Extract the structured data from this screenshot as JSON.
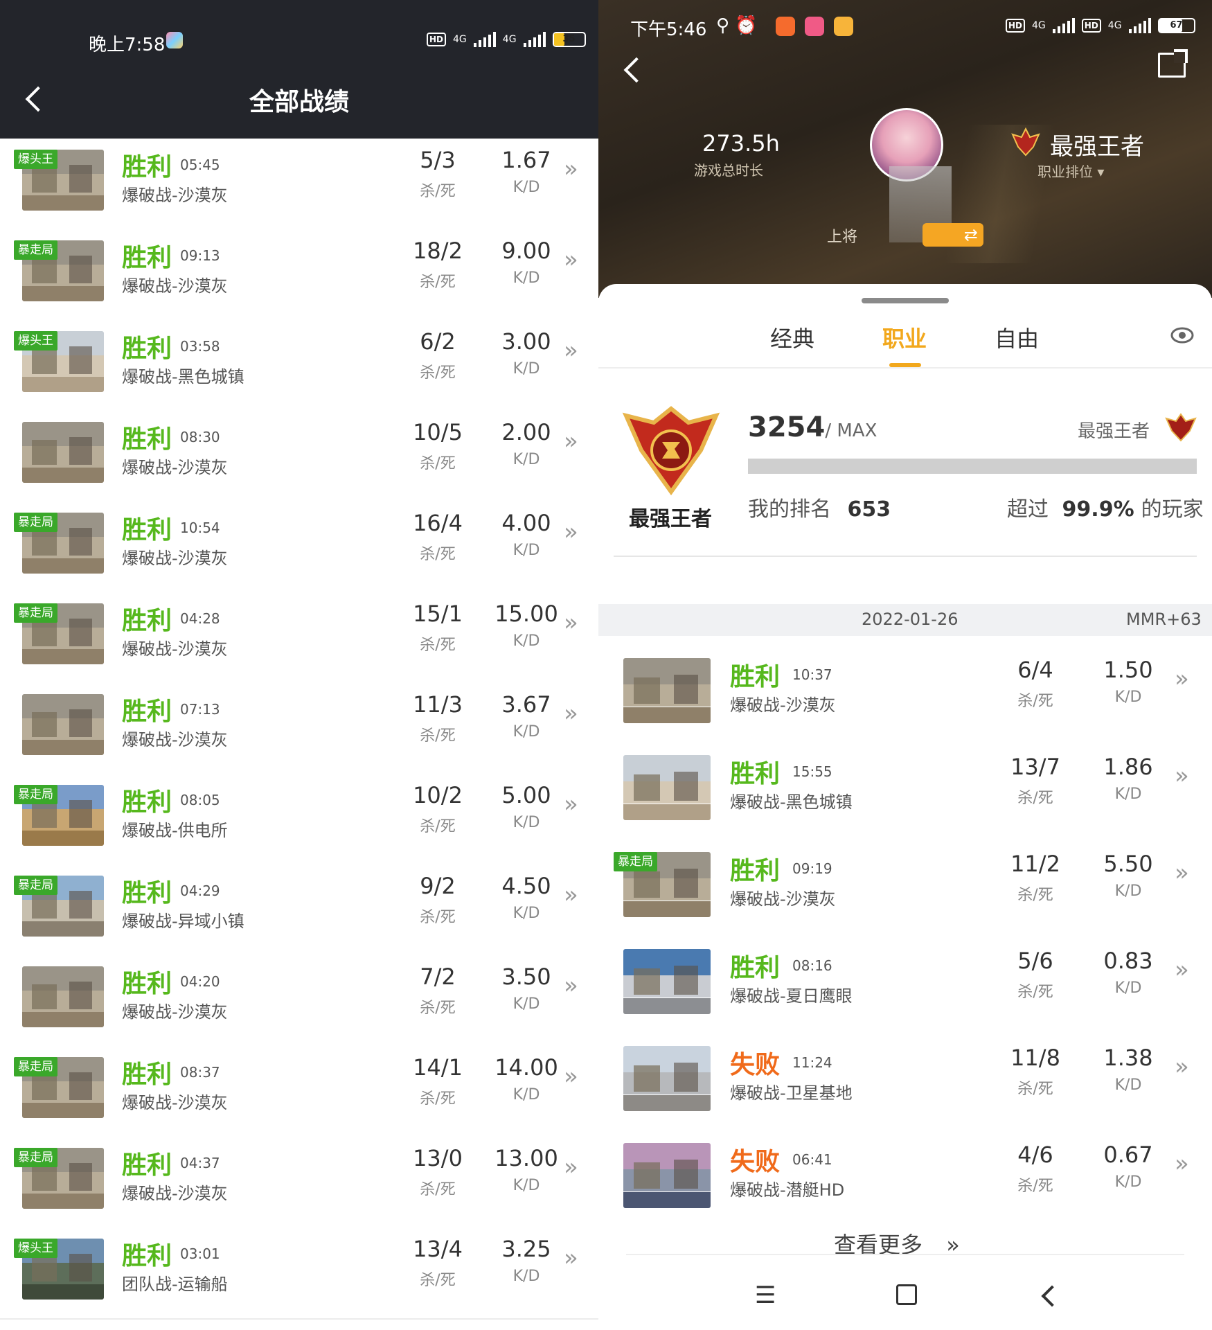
{
  "left": {
    "status": {
      "time": "晚上7:58",
      "network1": "4G",
      "network2": "4G",
      "battery": "35",
      "battery_level": 0.35
    },
    "title": "全部战绩",
    "kd_label_kills": "杀/死",
    "kd_label_ratio": "K/D",
    "matches": [
      {
        "tag": "爆头王",
        "result": "胜利",
        "duration": "05:45",
        "mode": "爆破战-沙漠灰",
        "kills_deaths": "5/3",
        "kd": "1.67",
        "outcome": "win",
        "map": "desert"
      },
      {
        "tag": "暴走局",
        "result": "胜利",
        "duration": "09:13",
        "mode": "爆破战-沙漠灰",
        "kills_deaths": "18/2",
        "kd": "9.00",
        "outcome": "win",
        "map": "desert"
      },
      {
        "tag": "爆头王",
        "result": "胜利",
        "duration": "03:58",
        "mode": "爆破战-黑色城镇",
        "kills_deaths": "6/2",
        "kd": "3.00",
        "outcome": "win",
        "map": "town"
      },
      {
        "tag": "",
        "result": "胜利",
        "duration": "08:30",
        "mode": "爆破战-沙漠灰",
        "kills_deaths": "10/5",
        "kd": "2.00",
        "outcome": "win",
        "map": "desert"
      },
      {
        "tag": "暴走局",
        "result": "胜利",
        "duration": "10:54",
        "mode": "爆破战-沙漠灰",
        "kills_deaths": "16/4",
        "kd": "4.00",
        "outcome": "win",
        "map": "desert"
      },
      {
        "tag": "暴走局",
        "result": "胜利",
        "duration": "04:28",
        "mode": "爆破战-沙漠灰",
        "kills_deaths": "15/1",
        "kd": "15.00",
        "outcome": "win",
        "map": "desert"
      },
      {
        "tag": "",
        "result": "胜利",
        "duration": "07:13",
        "mode": "爆破战-沙漠灰",
        "kills_deaths": "11/3",
        "kd": "3.67",
        "outcome": "win",
        "map": "desert"
      },
      {
        "tag": "暴走局",
        "result": "胜利",
        "duration": "08:05",
        "mode": "爆破战-供电所",
        "kills_deaths": "10/2",
        "kd": "5.00",
        "outcome": "win",
        "map": "power"
      },
      {
        "tag": "暴走局",
        "result": "胜利",
        "duration": "04:29",
        "mode": "爆破战-异域小镇",
        "kills_deaths": "9/2",
        "kd": "4.50",
        "outcome": "win",
        "map": "exotic"
      },
      {
        "tag": "",
        "result": "胜利",
        "duration": "04:20",
        "mode": "爆破战-沙漠灰",
        "kills_deaths": "7/2",
        "kd": "3.50",
        "outcome": "win",
        "map": "desert"
      },
      {
        "tag": "暴走局",
        "result": "胜利",
        "duration": "08:37",
        "mode": "爆破战-沙漠灰",
        "kills_deaths": "14/1",
        "kd": "14.00",
        "outcome": "win",
        "map": "desert"
      },
      {
        "tag": "暴走局",
        "result": "胜利",
        "duration": "04:37",
        "mode": "爆破战-沙漠灰",
        "kills_deaths": "13/0",
        "kd": "13.00",
        "outcome": "win",
        "map": "desert"
      },
      {
        "tag": "爆头王",
        "result": "胜利",
        "duration": "03:01",
        "mode": "团队战-运输船",
        "kills_deaths": "13/4",
        "kd": "3.25",
        "outcome": "win",
        "map": "ship"
      }
    ]
  },
  "right": {
    "status": {
      "time": "下午5:46",
      "network1": "4G",
      "network2": "4G",
      "battery": "67",
      "battery_level": 0.67
    },
    "hero": {
      "play_time": "273.5h",
      "play_time_label": "游戏总时长",
      "rank_title": "最强王者",
      "rank_label": "职业排位",
      "military_rank": "上将"
    },
    "tabs": [
      "经典",
      "职业",
      "自由"
    ],
    "active_tab": 1,
    "rank": {
      "badge_label": "最强王者",
      "score": "3254",
      "max": "/ MAX",
      "tier": "最强王者",
      "my_rank_label": "我的排名",
      "my_rank": "653",
      "exceed_prefix": "超过",
      "exceed_value": "99.9%",
      "exceed_suffix": "的玩家",
      "progress": 1.0
    },
    "date": "2022-01-26",
    "mmr": "MMR+63",
    "kd_label_kills": "杀/死",
    "kd_label_ratio": "K/D",
    "matches": [
      {
        "tag": "",
        "result": "胜利",
        "duration": "10:37",
        "mode": "爆破战-沙漠灰",
        "kills_deaths": "6/4",
        "kd": "1.50",
        "outcome": "win",
        "map": "desert"
      },
      {
        "tag": "",
        "result": "胜利",
        "duration": "15:55",
        "mode": "爆破战-黑色城镇",
        "kills_deaths": "13/7",
        "kd": "1.86",
        "outcome": "win",
        "map": "town"
      },
      {
        "tag": "暴走局",
        "result": "胜利",
        "duration": "09:19",
        "mode": "爆破战-沙漠灰",
        "kills_deaths": "11/2",
        "kd": "5.50",
        "outcome": "win",
        "map": "desert"
      },
      {
        "tag": "",
        "result": "胜利",
        "duration": "08:16",
        "mode": "爆破战-夏日鹰眼",
        "kills_deaths": "5/6",
        "kd": "0.83",
        "outcome": "win",
        "map": "summer"
      },
      {
        "tag": "",
        "result": "失败",
        "duration": "11:24",
        "mode": "爆破战-卫星基地",
        "kills_deaths": "11/8",
        "kd": "1.38",
        "outcome": "lose",
        "map": "satellite"
      },
      {
        "tag": "",
        "result": "失败",
        "duration": "06:41",
        "mode": "爆破战-潜艇HD",
        "kills_deaths": "4/6",
        "kd": "0.67",
        "outcome": "lose",
        "map": "sub"
      }
    ],
    "more": "查看更多"
  },
  "colors": {
    "win": "#56b81d",
    "lose": "#f06a1a",
    "tag": "#3aa82a",
    "accent": "#f2a81d"
  }
}
